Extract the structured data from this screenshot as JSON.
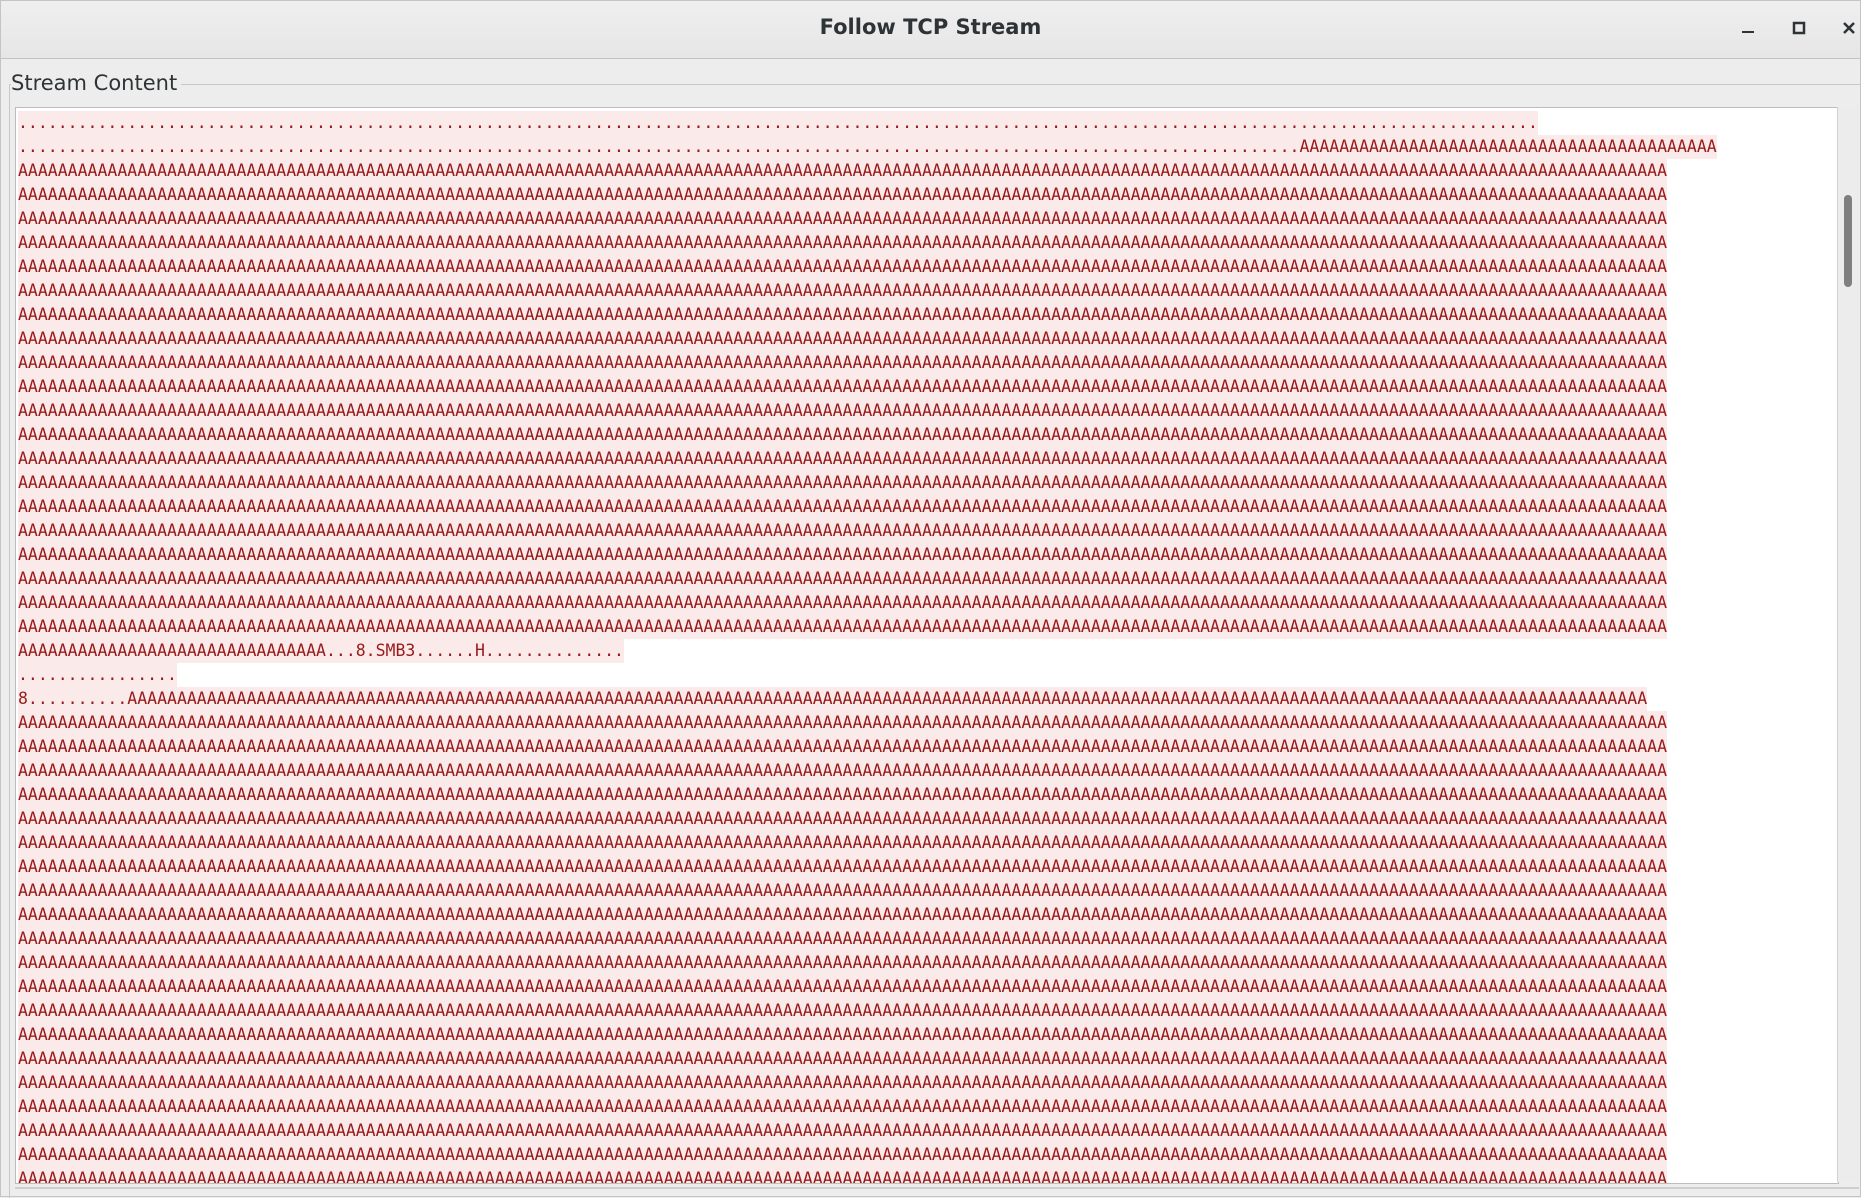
{
  "window": {
    "title": "Follow TCP Stream"
  },
  "controls": {
    "minimize_icon": "minimize-icon",
    "maximize_icon": "maximize-icon",
    "close_icon": "close-icon"
  },
  "group": {
    "label": "Stream Content"
  },
  "stream": {
    "lines": [
      ".........................................................................................................................................................",
      ".................................................................................................................................AAAAAAAAAAAAAAAAAAAAAAAAAAAAAAAAAAAAAAAAAA",
      "AAAAAAAAAAAAAAAAAAAAAAAAAAAAAAAAAAAAAAAAAAAAAAAAAAAAAAAAAAAAAAAAAAAAAAAAAAAAAAAAAAAAAAAAAAAAAAAAAAAAAAAAAAAAAAAAAAAAAAAAAAAAAAAAAAAAAAAAAAAAAAAAAAAAAAAAAAAAAAAAAAAAAA",
      "AAAAAAAAAAAAAAAAAAAAAAAAAAAAAAAAAAAAAAAAAAAAAAAAAAAAAAAAAAAAAAAAAAAAAAAAAAAAAAAAAAAAAAAAAAAAAAAAAAAAAAAAAAAAAAAAAAAAAAAAAAAAAAAAAAAAAAAAAAAAAAAAAAAAAAAAAAAAAAAAAAAAAA",
      "AAAAAAAAAAAAAAAAAAAAAAAAAAAAAAAAAAAAAAAAAAAAAAAAAAAAAAAAAAAAAAAAAAAAAAAAAAAAAAAAAAAAAAAAAAAAAAAAAAAAAAAAAAAAAAAAAAAAAAAAAAAAAAAAAAAAAAAAAAAAAAAAAAAAAAAAAAAAAAAAAAAAAA",
      "AAAAAAAAAAAAAAAAAAAAAAAAAAAAAAAAAAAAAAAAAAAAAAAAAAAAAAAAAAAAAAAAAAAAAAAAAAAAAAAAAAAAAAAAAAAAAAAAAAAAAAAAAAAAAAAAAAAAAAAAAAAAAAAAAAAAAAAAAAAAAAAAAAAAAAAAAAAAAAAAAAAAAA",
      "AAAAAAAAAAAAAAAAAAAAAAAAAAAAAAAAAAAAAAAAAAAAAAAAAAAAAAAAAAAAAAAAAAAAAAAAAAAAAAAAAAAAAAAAAAAAAAAAAAAAAAAAAAAAAAAAAAAAAAAAAAAAAAAAAAAAAAAAAAAAAAAAAAAAAAAAAAAAAAAAAAAAAA",
      "AAAAAAAAAAAAAAAAAAAAAAAAAAAAAAAAAAAAAAAAAAAAAAAAAAAAAAAAAAAAAAAAAAAAAAAAAAAAAAAAAAAAAAAAAAAAAAAAAAAAAAAAAAAAAAAAAAAAAAAAAAAAAAAAAAAAAAAAAAAAAAAAAAAAAAAAAAAAAAAAAAAAAA",
      "AAAAAAAAAAAAAAAAAAAAAAAAAAAAAAAAAAAAAAAAAAAAAAAAAAAAAAAAAAAAAAAAAAAAAAAAAAAAAAAAAAAAAAAAAAAAAAAAAAAAAAAAAAAAAAAAAAAAAAAAAAAAAAAAAAAAAAAAAAAAAAAAAAAAAAAAAAAAAAAAAAAAAA",
      "AAAAAAAAAAAAAAAAAAAAAAAAAAAAAAAAAAAAAAAAAAAAAAAAAAAAAAAAAAAAAAAAAAAAAAAAAAAAAAAAAAAAAAAAAAAAAAAAAAAAAAAAAAAAAAAAAAAAAAAAAAAAAAAAAAAAAAAAAAAAAAAAAAAAAAAAAAAAAAAAAAAAAA",
      "AAAAAAAAAAAAAAAAAAAAAAAAAAAAAAAAAAAAAAAAAAAAAAAAAAAAAAAAAAAAAAAAAAAAAAAAAAAAAAAAAAAAAAAAAAAAAAAAAAAAAAAAAAAAAAAAAAAAAAAAAAAAAAAAAAAAAAAAAAAAAAAAAAAAAAAAAAAAAAAAAAAAAA",
      "AAAAAAAAAAAAAAAAAAAAAAAAAAAAAAAAAAAAAAAAAAAAAAAAAAAAAAAAAAAAAAAAAAAAAAAAAAAAAAAAAAAAAAAAAAAAAAAAAAAAAAAAAAAAAAAAAAAAAAAAAAAAAAAAAAAAAAAAAAAAAAAAAAAAAAAAAAAAAAAAAAAAAA",
      "AAAAAAAAAAAAAAAAAAAAAAAAAAAAAAAAAAAAAAAAAAAAAAAAAAAAAAAAAAAAAAAAAAAAAAAAAAAAAAAAAAAAAAAAAAAAAAAAAAAAAAAAAAAAAAAAAAAAAAAAAAAAAAAAAAAAAAAAAAAAAAAAAAAAAAAAAAAAAAAAAAAAAA",
      "AAAAAAAAAAAAAAAAAAAAAAAAAAAAAAAAAAAAAAAAAAAAAAAAAAAAAAAAAAAAAAAAAAAAAAAAAAAAAAAAAAAAAAAAAAAAAAAAAAAAAAAAAAAAAAAAAAAAAAAAAAAAAAAAAAAAAAAAAAAAAAAAAAAAAAAAAAAAAAAAAAAAAA",
      "AAAAAAAAAAAAAAAAAAAAAAAAAAAAAAAAAAAAAAAAAAAAAAAAAAAAAAAAAAAAAAAAAAAAAAAAAAAAAAAAAAAAAAAAAAAAAAAAAAAAAAAAAAAAAAAAAAAAAAAAAAAAAAAAAAAAAAAAAAAAAAAAAAAAAAAAAAAAAAAAAAAAAA",
      "AAAAAAAAAAAAAAAAAAAAAAAAAAAAAAAAAAAAAAAAAAAAAAAAAAAAAAAAAAAAAAAAAAAAAAAAAAAAAAAAAAAAAAAAAAAAAAAAAAAAAAAAAAAAAAAAAAAAAAAAAAAAAAAAAAAAAAAAAAAAAAAAAAAAAAAAAAAAAAAAAAAAAA",
      "AAAAAAAAAAAAAAAAAAAAAAAAAAAAAAAAAAAAAAAAAAAAAAAAAAAAAAAAAAAAAAAAAAAAAAAAAAAAAAAAAAAAAAAAAAAAAAAAAAAAAAAAAAAAAAAAAAAAAAAAAAAAAAAAAAAAAAAAAAAAAAAAAAAAAAAAAAAAAAAAAAAAAA",
      "AAAAAAAAAAAAAAAAAAAAAAAAAAAAAAAAAAAAAAAAAAAAAAAAAAAAAAAAAAAAAAAAAAAAAAAAAAAAAAAAAAAAAAAAAAAAAAAAAAAAAAAAAAAAAAAAAAAAAAAAAAAAAAAAAAAAAAAAAAAAAAAAAAAAAAAAAAAAAAAAAAAAAA",
      "AAAAAAAAAAAAAAAAAAAAAAAAAAAAAAAAAAAAAAAAAAAAAAAAAAAAAAAAAAAAAAAAAAAAAAAAAAAAAAAAAAAAAAAAAAAAAAAAAAAAAAAAAAAAAAAAAAAAAAAAAAAAAAAAAAAAAAAAAAAAAAAAAAAAAAAAAAAAAAAAAAAAAA",
      "AAAAAAAAAAAAAAAAAAAAAAAAAAAAAAAAAAAAAAAAAAAAAAAAAAAAAAAAAAAAAAAAAAAAAAAAAAAAAAAAAAAAAAAAAAAAAAAAAAAAAAAAAAAAAAAAAAAAAAAAAAAAAAAAAAAAAAAAAAAAAAAAAAAAAAAAAAAAAAAAAAAAAA",
      "AAAAAAAAAAAAAAAAAAAAAAAAAAAAAAAAAAAAAAAAAAAAAAAAAAAAAAAAAAAAAAAAAAAAAAAAAAAAAAAAAAAAAAAAAAAAAAAAAAAAAAAAAAAAAAAAAAAAAAAAAAAAAAAAAAAAAAAAAAAAAAAAAAAAAAAAAAAAAAAAAAAAAA",
      "AAAAAAAAAAAAAAAAAAAAAAAAAAAAAAAAAAAAAAAAAAAAAAAAAAAAAAAAAAAAAAAAAAAAAAAAAAAAAAAAAAAAAAAAAAAAAAAAAAAAAAAAAAAAAAAAAAAAAAAAAAAAAAAAAAAAAAAAAAAAAAAAAAAAAAAAAAAAAAAAAAAAAA",
      "AAAAAAAAAAAAAAAAAAAAAAAAAAAAAAA...8.SMB3......H..............",
      "................",
      "8..........AAAAAAAAAAAAAAAAAAAAAAAAAAAAAAAAAAAAAAAAAAAAAAAAAAAAAAAAAAAAAAAAAAAAAAAAAAAAAAAAAAAAAAAAAAAAAAAAAAAAAAAAAAAAAAAAAAAAAAAAAAAAAAAAAAAAAAAAAAAAAAAAAAAAAAAAA",
      "AAAAAAAAAAAAAAAAAAAAAAAAAAAAAAAAAAAAAAAAAAAAAAAAAAAAAAAAAAAAAAAAAAAAAAAAAAAAAAAAAAAAAAAAAAAAAAAAAAAAAAAAAAAAAAAAAAAAAAAAAAAAAAAAAAAAAAAAAAAAAAAAAAAAAAAAAAAAAAAAAAAAAA",
      "AAAAAAAAAAAAAAAAAAAAAAAAAAAAAAAAAAAAAAAAAAAAAAAAAAAAAAAAAAAAAAAAAAAAAAAAAAAAAAAAAAAAAAAAAAAAAAAAAAAAAAAAAAAAAAAAAAAAAAAAAAAAAAAAAAAAAAAAAAAAAAAAAAAAAAAAAAAAAAAAAAAAAA",
      "AAAAAAAAAAAAAAAAAAAAAAAAAAAAAAAAAAAAAAAAAAAAAAAAAAAAAAAAAAAAAAAAAAAAAAAAAAAAAAAAAAAAAAAAAAAAAAAAAAAAAAAAAAAAAAAAAAAAAAAAAAAAAAAAAAAAAAAAAAAAAAAAAAAAAAAAAAAAAAAAAAAAAA",
      "AAAAAAAAAAAAAAAAAAAAAAAAAAAAAAAAAAAAAAAAAAAAAAAAAAAAAAAAAAAAAAAAAAAAAAAAAAAAAAAAAAAAAAAAAAAAAAAAAAAAAAAAAAAAAAAAAAAAAAAAAAAAAAAAAAAAAAAAAAAAAAAAAAAAAAAAAAAAAAAAAAAAAA",
      "AAAAAAAAAAAAAAAAAAAAAAAAAAAAAAAAAAAAAAAAAAAAAAAAAAAAAAAAAAAAAAAAAAAAAAAAAAAAAAAAAAAAAAAAAAAAAAAAAAAAAAAAAAAAAAAAAAAAAAAAAAAAAAAAAAAAAAAAAAAAAAAAAAAAAAAAAAAAAAAAAAAAAA",
      "AAAAAAAAAAAAAAAAAAAAAAAAAAAAAAAAAAAAAAAAAAAAAAAAAAAAAAAAAAAAAAAAAAAAAAAAAAAAAAAAAAAAAAAAAAAAAAAAAAAAAAAAAAAAAAAAAAAAAAAAAAAAAAAAAAAAAAAAAAAAAAAAAAAAAAAAAAAAAAAAAAAAAA",
      "AAAAAAAAAAAAAAAAAAAAAAAAAAAAAAAAAAAAAAAAAAAAAAAAAAAAAAAAAAAAAAAAAAAAAAAAAAAAAAAAAAAAAAAAAAAAAAAAAAAAAAAAAAAAAAAAAAAAAAAAAAAAAAAAAAAAAAAAAAAAAAAAAAAAAAAAAAAAAAAAAAAAAA",
      "AAAAAAAAAAAAAAAAAAAAAAAAAAAAAAAAAAAAAAAAAAAAAAAAAAAAAAAAAAAAAAAAAAAAAAAAAAAAAAAAAAAAAAAAAAAAAAAAAAAAAAAAAAAAAAAAAAAAAAAAAAAAAAAAAAAAAAAAAAAAAAAAAAAAAAAAAAAAAAAAAAAAAA",
      "AAAAAAAAAAAAAAAAAAAAAAAAAAAAAAAAAAAAAAAAAAAAAAAAAAAAAAAAAAAAAAAAAAAAAAAAAAAAAAAAAAAAAAAAAAAAAAAAAAAAAAAAAAAAAAAAAAAAAAAAAAAAAAAAAAAAAAAAAAAAAAAAAAAAAAAAAAAAAAAAAAAAAA",
      "AAAAAAAAAAAAAAAAAAAAAAAAAAAAAAAAAAAAAAAAAAAAAAAAAAAAAAAAAAAAAAAAAAAAAAAAAAAAAAAAAAAAAAAAAAAAAAAAAAAAAAAAAAAAAAAAAAAAAAAAAAAAAAAAAAAAAAAAAAAAAAAAAAAAAAAAAAAAAAAAAAAAAA",
      "AAAAAAAAAAAAAAAAAAAAAAAAAAAAAAAAAAAAAAAAAAAAAAAAAAAAAAAAAAAAAAAAAAAAAAAAAAAAAAAAAAAAAAAAAAAAAAAAAAAAAAAAAAAAAAAAAAAAAAAAAAAAAAAAAAAAAAAAAAAAAAAAAAAAAAAAAAAAAAAAAAAAAA",
      "AAAAAAAAAAAAAAAAAAAAAAAAAAAAAAAAAAAAAAAAAAAAAAAAAAAAAAAAAAAAAAAAAAAAAAAAAAAAAAAAAAAAAAAAAAAAAAAAAAAAAAAAAAAAAAAAAAAAAAAAAAAAAAAAAAAAAAAAAAAAAAAAAAAAAAAAAAAAAAAAAAAAAA",
      "AAAAAAAAAAAAAAAAAAAAAAAAAAAAAAAAAAAAAAAAAAAAAAAAAAAAAAAAAAAAAAAAAAAAAAAAAAAAAAAAAAAAAAAAAAAAAAAAAAAAAAAAAAAAAAAAAAAAAAAAAAAAAAAAAAAAAAAAAAAAAAAAAAAAAAAAAAAAAAAAAAAAAA",
      "AAAAAAAAAAAAAAAAAAAAAAAAAAAAAAAAAAAAAAAAAAAAAAAAAAAAAAAAAAAAAAAAAAAAAAAAAAAAAAAAAAAAAAAAAAAAAAAAAAAAAAAAAAAAAAAAAAAAAAAAAAAAAAAAAAAAAAAAAAAAAAAAAAAAAAAAAAAAAAAAAAAAAA",
      "AAAAAAAAAAAAAAAAAAAAAAAAAAAAAAAAAAAAAAAAAAAAAAAAAAAAAAAAAAAAAAAAAAAAAAAAAAAAAAAAAAAAAAAAAAAAAAAAAAAAAAAAAAAAAAAAAAAAAAAAAAAAAAAAAAAAAAAAAAAAAAAAAAAAAAAAAAAAAAAAAAAAAA",
      "AAAAAAAAAAAAAAAAAAAAAAAAAAAAAAAAAAAAAAAAAAAAAAAAAAAAAAAAAAAAAAAAAAAAAAAAAAAAAAAAAAAAAAAAAAAAAAAAAAAAAAAAAAAAAAAAAAAAAAAAAAAAAAAAAAAAAAAAAAAAAAAAAAAAAAAAAAAAAAAAAAAAAA",
      "AAAAAAAAAAAAAAAAAAAAAAAAAAAAAAAAAAAAAAAAAAAAAAAAAAAAAAAAAAAAAAAAAAAAAAAAAAAAAAAAAAAAAAAAAAAAAAAAAAAAAAAAAAAAAAAAAAAAAAAAAAAAAAAAAAAAAAAAAAAAAAAAAAAAAAAAAAAAAAAAAAAAAA",
      "AAAAAAAAAAAAAAAAAAAAAAAAAAAAAAAAAAAAAAAAAAAAAAAAAAAAAAAAAAAAAAAAAAAAAAAAAAAAAAAAAAAAAAAAAAAAAAAAAAAAAAAAAAAAAAAAAAAAAAAAAAAAAAAAAAAAAAAAAAAAAAAAAAAAAAAAAAAAAAAAAAAAAA",
      "AAAAAAAAAAAAAAAAAAAAAAAAAAAAAAAAAAAAAAAAAAAAAAAAAAAAAAAAAAAAAAAAAAAAAAAAAAAAAAAAAAAAAAAAAAAAAAAAAAAAAAAAAAAAAAAAAAAAAAAAAAAAAAAAAAAAAAAAAAAAAAAAAAAAAAAAAAAAAAAAAAAAAA",
      "AAAAAAAAAAAAAAAAAAAAAAAAAAAAAAAAAAAAAAAAAAAAAAAAAAAAAAAAAAAAAAAAAAAAAAAAAAAAAAAAAAAAAAAAAAAAAAAAAAAAAAAAAAAAAAAAAAAAAAAAAAAAAAAAAAAAAAAAAAAAAAAAAAAAAAAAAAAAAAAAAAAAAA"
    ],
    "text_color": "#9a1a1a",
    "highlight_color": "#fbeaea"
  }
}
